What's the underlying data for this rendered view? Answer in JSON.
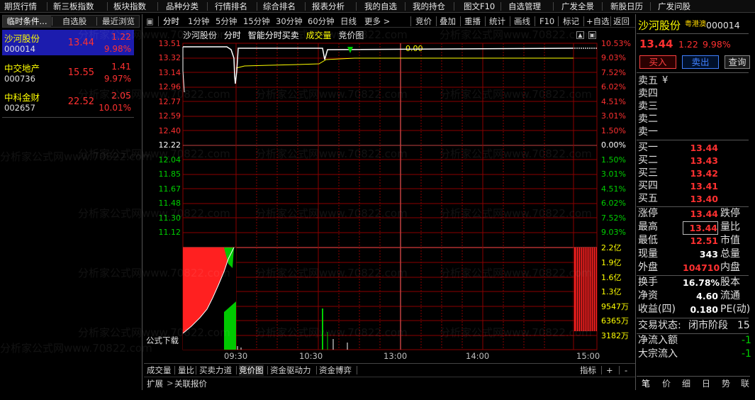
{
  "top_menu": [
    "期货行情",
    "新三板指数",
    "板块指数",
    "品种分类",
    "行情排名",
    "综合排名",
    "报表分析",
    "我的自选",
    "我的持仓",
    "图文F10",
    "自选管理",
    "广发全景",
    "新股日历",
    "广发问股"
  ],
  "left_tabs": [
    "临时条件...",
    "自选股",
    "最近浏览"
  ],
  "stock_list": [
    {
      "name": "沙河股份",
      "code": "000014",
      "price": "13.44",
      "change": "1.22",
      "pct": "9.98%"
    },
    {
      "name": "中交地产",
      "code": "000736",
      "price": "15.55",
      "change": "1.41",
      "pct": "9.97%"
    },
    {
      "name": "中科金财",
      "code": "002657",
      "price": "22.52",
      "change": "2.05",
      "pct": "10.01%"
    }
  ],
  "chart_toolbar": [
    "分时",
    "1分钟",
    "5分钟",
    "15分钟",
    "30分钟",
    "60分钟",
    "日线",
    "更多 >",
    "竞价",
    "叠加",
    "重播",
    "统计",
    "画线",
    "F10",
    "标记",
    "+自选",
    "返回"
  ],
  "chart_header": {
    "stock": "沙河股份",
    "mode": "分时",
    "indicator": "智能分时买卖",
    "volume": "成交量",
    "auction": "竞价图",
    "current_value": "0.00"
  },
  "price_axis": [
    "13.51",
    "13.32",
    "13.14",
    "12.96",
    "12.77",
    "12.59",
    "12.40",
    "12.22",
    "12.04",
    "11.85",
    "11.67",
    "11.48",
    "11.30",
    "11.12"
  ],
  "pct_axis": [
    "10.53%",
    "9.03%",
    "7.52%",
    "6.02%",
    "4.51%",
    "3.01%",
    "1.50%",
    "0.00%",
    "1.50%",
    "3.01%",
    "4.51%",
    "6.02%",
    "7.52%",
    "9.03%"
  ],
  "volume_axis": [
    "2.2亿",
    "1.9亿",
    "1.6亿",
    "1.3亿",
    "9547万",
    "6365万",
    "3182万"
  ],
  "time_axis": [
    "09:30",
    "10:30",
    "13:00",
    "14:00",
    "15:00"
  ],
  "formula_download": "公式下载",
  "bottom_tabs": [
    "成交量",
    "量比",
    "买卖力道",
    "竞价图",
    "资金驱动力",
    "资金博弈"
  ],
  "bottom_right": [
    "指标",
    "+",
    "-"
  ],
  "extension": [
    "扩展",
    ">",
    "关联报价"
  ],
  "quote": {
    "name": "沙河股份",
    "tag": "粤港澳",
    "code": "000014",
    "price": "13.44",
    "change": "1.22",
    "pct": "9.98%",
    "buy_label": "买入",
    "sell_label": "卖出",
    "query_label": "查询",
    "sell_levels": [
      {
        "label": "卖五",
        "value": "¥"
      },
      {
        "label": "卖四",
        "value": ""
      },
      {
        "label": "卖三",
        "value": ""
      },
      {
        "label": "卖二",
        "value": ""
      },
      {
        "label": "卖一",
        "value": ""
      }
    ],
    "buy_levels": [
      {
        "label": "买一",
        "value": "13.44"
      },
      {
        "label": "买二",
        "value": "13.43"
      },
      {
        "label": "买三",
        "value": "13.42"
      },
      {
        "label": "买四",
        "value": "13.41"
      },
      {
        "label": "买五",
        "value": "13.40"
      }
    ],
    "stats": [
      {
        "label": "涨停",
        "value": "13.44",
        "label2": "跌停"
      },
      {
        "label": "最高",
        "value": "13.44",
        "label2": "量比"
      },
      {
        "label": "最低",
        "value": "12.51",
        "label2": "市值"
      },
      {
        "label": "现量",
        "value": "343",
        "label2": "总量"
      },
      {
        "label": "外盘",
        "value": "104710",
        "label2": "内盘"
      },
      {
        "label": "换手",
        "value": "16.78%",
        "label2": "股本"
      },
      {
        "label": "净资",
        "value": "4.60",
        "label2": "流通"
      },
      {
        "label": "收益(四)",
        "value": "0.180",
        "label2": "PE(动)"
      }
    ],
    "status_label": "交易状态:",
    "status_value": "闭市阶段",
    "status_extra": "15",
    "net_inflow_label": "净流入额",
    "net_inflow_value": "-1",
    "block_inflow_label": "大宗流入",
    "block_inflow_value": "-1"
  },
  "right_bottom_tabs": [
    "笔",
    "价",
    "细",
    "日",
    "势",
    "联"
  ],
  "watermark": "分析家公式网www.70822.com",
  "colors": {
    "up": "#ff3030",
    "down": "#00d000",
    "label": "#ffff00",
    "grid": "#8b0000",
    "flat": "#ffffff"
  }
}
